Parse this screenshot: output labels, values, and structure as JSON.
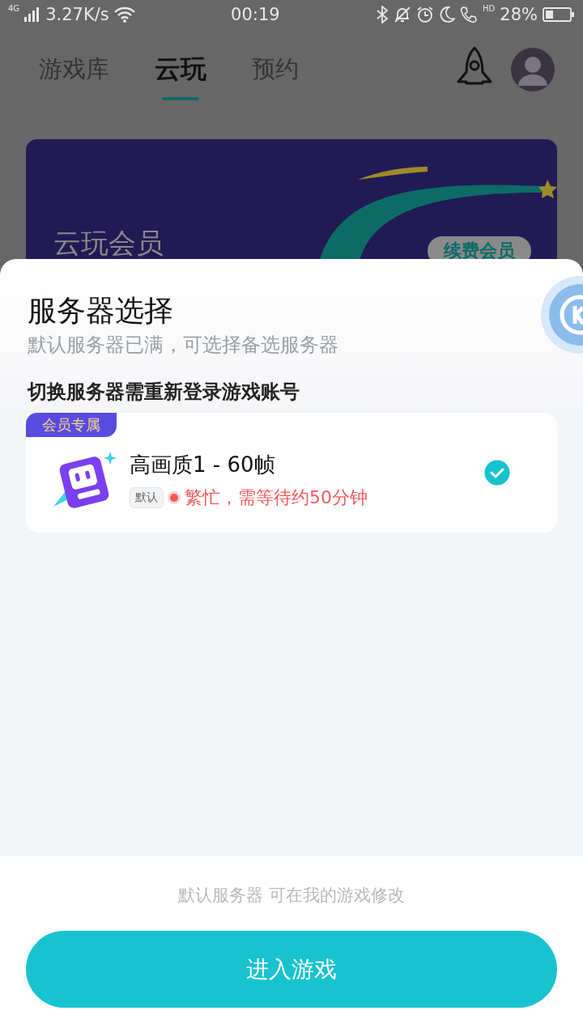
{
  "status_bar": {
    "network_type": "4G",
    "speed": "3.27K/s",
    "time": "00:19",
    "call_label": "HD",
    "battery": "28%"
  },
  "tabs": [
    {
      "label": "游戏库",
      "selected": false
    },
    {
      "label": "云玩",
      "selected": true
    },
    {
      "label": "预约",
      "selected": false
    }
  ],
  "banner": {
    "title": "云玩会员",
    "button": "续费会员"
  },
  "sheet": {
    "title": "服务器选择",
    "subtitle": "默认服务器已满，可选择备选服务器",
    "note": "切换服务器需重新登录游戏账号",
    "servers": [
      {
        "badge": "会员专属",
        "name": "高画质1 - 60帧",
        "tag": "默认",
        "status": "繁忙，需等待约50分钟",
        "color": "#f0585a",
        "selected": true
      }
    ]
  },
  "footer": {
    "hint": "默认服务器 可在我的游戏修改",
    "button": "进入游戏"
  }
}
